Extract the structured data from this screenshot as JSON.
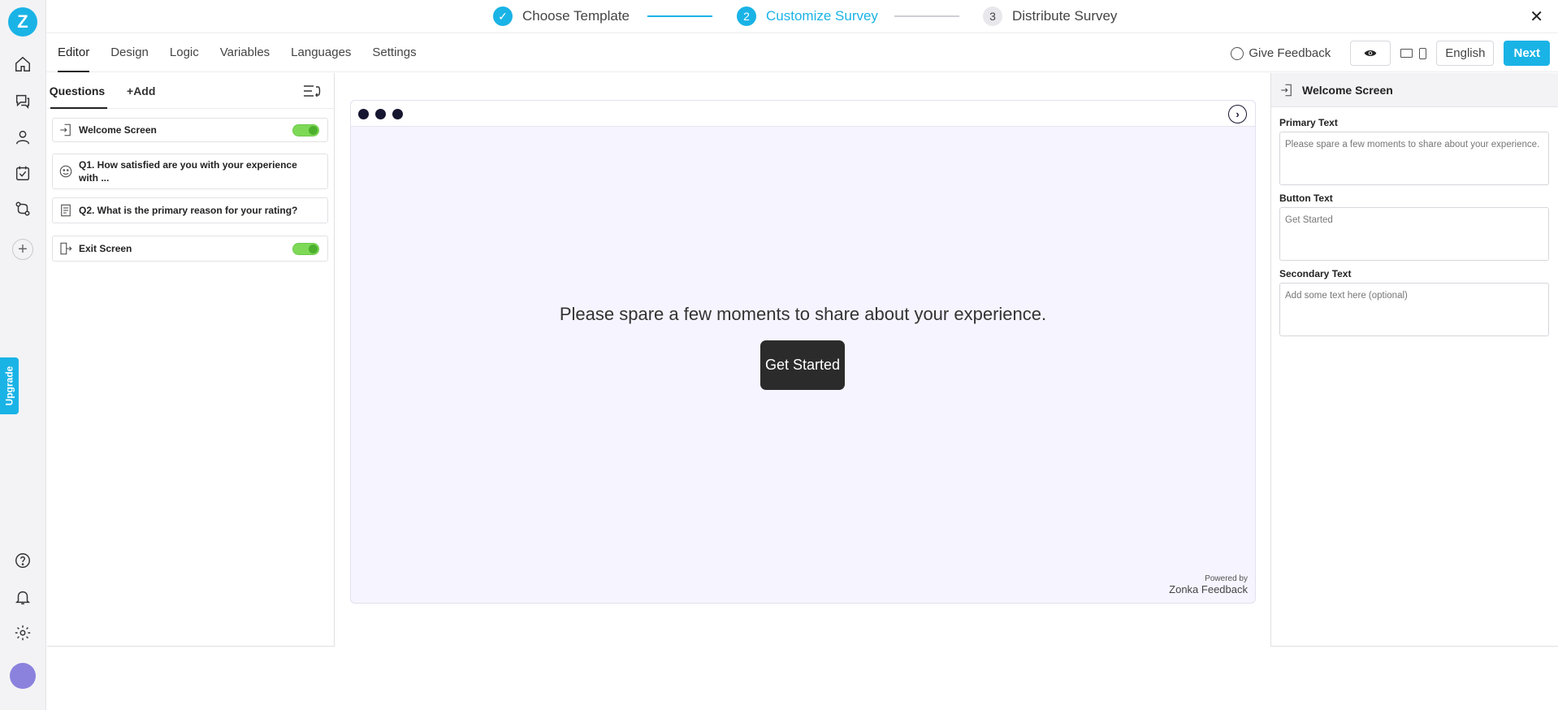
{
  "steps": [
    {
      "num": "✓",
      "label": "Choose Template"
    },
    {
      "num": "2",
      "label": "Customize Survey"
    },
    {
      "num": "3",
      "label": "Distribute Survey"
    }
  ],
  "close": "✕",
  "rail": {
    "logo": "Z",
    "upgrade": "Upgrade",
    "add": "+"
  },
  "toolbar": {
    "tabs": [
      "Editor",
      "Design",
      "Logic",
      "Variables",
      "Languages",
      "Settings"
    ],
    "feedback": "Give Feedback",
    "language": "English",
    "next": "Next"
  },
  "questions": {
    "tab": "Questions",
    "add": "Add",
    "add_symbol": "+",
    "items": [
      {
        "label": "Welcome Screen",
        "toggle": true
      },
      {
        "label": "Q1. How satisfied are you with your experience with ...",
        "toggle": false
      },
      {
        "label": "Q2. What is the primary reason for your rating?",
        "toggle": false
      },
      {
        "label": "Exit Screen",
        "toggle": true
      }
    ]
  },
  "preview": {
    "text": "Please spare a few moments to share about your experience.",
    "button": "Get Started",
    "powered_by": "Powered by",
    "brand": "Zonka Feedback",
    "next_arrow": "›"
  },
  "panel": {
    "title": "Welcome Screen",
    "primary_label": "Primary Text",
    "primary_value": "Please spare a few moments to share about your experience.",
    "button_label": "Button Text",
    "button_value": "Get Started",
    "secondary_label": "Secondary Text",
    "secondary_placeholder": "Add some text here (optional)"
  },
  "colors": {
    "accent": "#1ab3e6",
    "toggle_on": "#7ed957",
    "preview_bg": "#f6f4fe",
    "button_dark": "#2b2b2b"
  }
}
